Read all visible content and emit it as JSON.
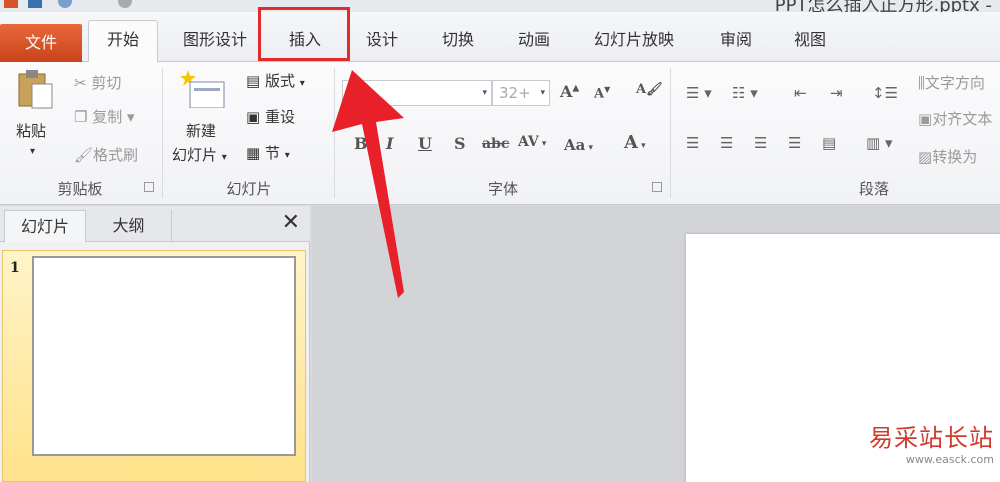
{
  "window": {
    "title": "PPT怎么插入正方形.pptx -"
  },
  "tabs": {
    "file": "文件",
    "home": "开始",
    "graphic_design": "图形设计",
    "insert": "插入",
    "design": "设计",
    "transitions": "切换",
    "animations": "动画",
    "slideshow": "幻灯片放映",
    "review": "审阅",
    "view": "视图"
  },
  "clipboard": {
    "paste": "粘贴",
    "cut": "剪切",
    "copy": "复制",
    "format_painter": "格式刷",
    "label": "剪贴板"
  },
  "slides_group": {
    "new_slide_line1": "新建",
    "new_slide_line2": "幻灯片",
    "layout": "版式",
    "reset": "重设",
    "section": "节",
    "label": "幻灯片"
  },
  "font_group": {
    "font_name": "",
    "font_size": "32+",
    "label": "字体",
    "bold": "B",
    "italic": "I",
    "underline": "U",
    "shadow": "S",
    "strike": "abc",
    "spacing": "AV",
    "case": "Aa",
    "color": "A"
  },
  "paragraph_group": {
    "text_direction": "文字方向",
    "align_text": "对齐文本",
    "convert": "转换为",
    "label": "段落"
  },
  "left_panel": {
    "tab_slides": "幻灯片",
    "tab_outline": "大纲",
    "close": "✕",
    "slide_number": "1"
  },
  "watermark": {
    "main": "易采站长站",
    "url": "www.easck.com"
  },
  "colors": {
    "file_tab": "#d9532a",
    "highlight": "#e32b2b",
    "arrow": "#e8202a",
    "thumb_bg": "#ffe28a"
  }
}
